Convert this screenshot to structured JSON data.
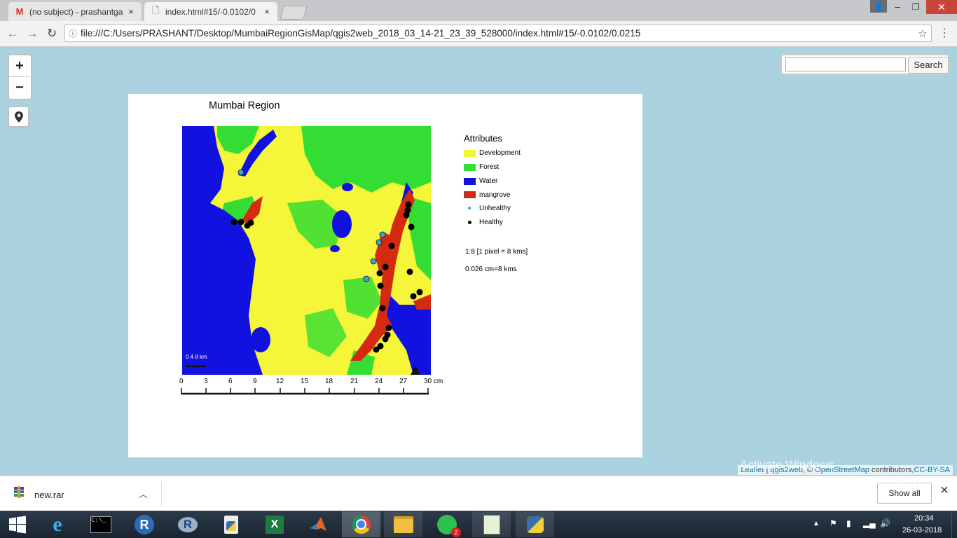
{
  "browser": {
    "tabs": [
      {
        "icon": "M",
        "title": "(no subject) - prashantga",
        "close": "×",
        "active": false
      },
      {
        "icon": "🗋",
        "title": "index.html#15/-0.0102/0",
        "close": "×",
        "active": true
      }
    ],
    "url": "file:///C:/Users/PRASHANT/Desktop/MumbaiRegionGisMap/qgis2web_2018_03_14-21_23_39_528000/index.html#15/-0.0102/0.0215"
  },
  "map_controls": {
    "zoom_in": "+",
    "zoom_out": "−",
    "search_button": "Search",
    "search_value": ""
  },
  "map_layout": {
    "title": "Mumbai Region",
    "legend_title": "Attributes",
    "legend": [
      {
        "label": "Development",
        "color": "#f5f53a"
      },
      {
        "label": "Forest",
        "color": "#33dd33"
      },
      {
        "label": "Water",
        "color": "#1212e0"
      },
      {
        "label": "mangrove",
        "color": "#d42a10"
      },
      {
        "label": "Unhealthy",
        "color": "#3aa6c9"
      },
      {
        "label": "Healthy",
        "color": "#000000"
      }
    ],
    "scale_ratio": "1:8 [1 pixel = 8 kms]",
    "scale_cm": "0.026 cm=8 kms",
    "inset_scale": "0  4  8 km",
    "ruler_ticks": [
      "0",
      "3",
      "6",
      "9",
      "12",
      "15",
      "18",
      "21",
      "24",
      "27",
      "30 cm"
    ]
  },
  "attribution": {
    "leaflet": "Leaflet",
    "sep1": " | ",
    "qgis2web": "qgis2web",
    "sep2": ", © ",
    "osm": "OpenStreetMap",
    "contrib": " contributors,",
    "license": "CC-BY-SA"
  },
  "watermark": {
    "line1": "Activate Windows",
    "line2": "Go to PC settings to activate Windows."
  },
  "downloads": {
    "file": "new.rar",
    "show_all": "Show all"
  },
  "taskbar": {
    "time": "20:34",
    "date": "26-03-2018"
  }
}
